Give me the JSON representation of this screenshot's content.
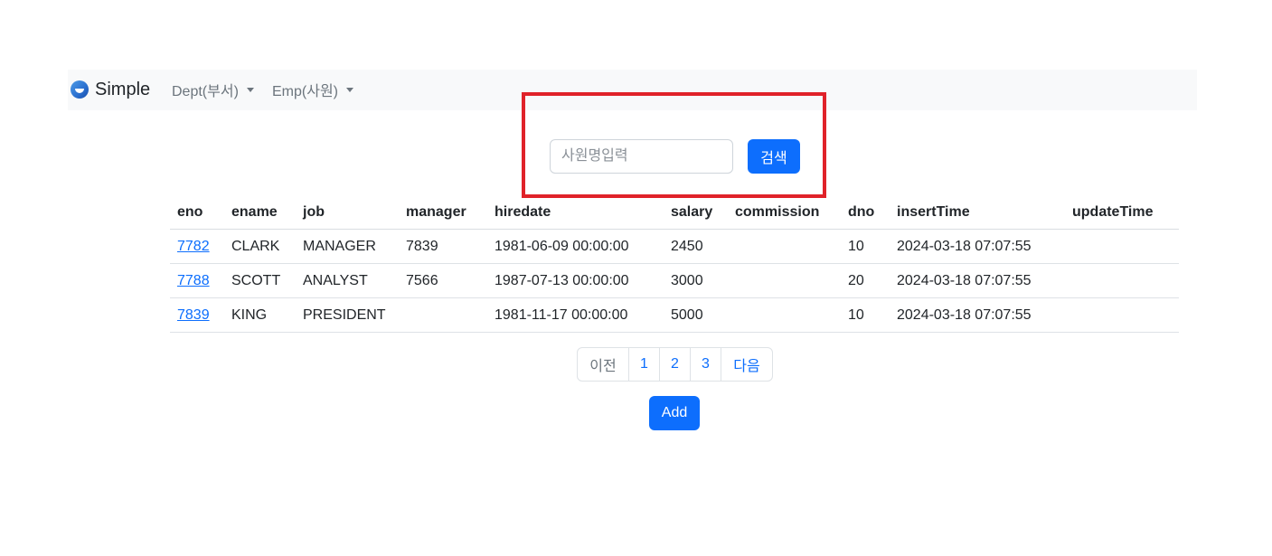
{
  "navbar": {
    "brand": "Simple",
    "menus": [
      {
        "label": "Dept(부서)"
      },
      {
        "label": "Emp(사원)"
      }
    ]
  },
  "search": {
    "placeholder": "사원명입력",
    "value": "",
    "button_label": "검색"
  },
  "table": {
    "headers": [
      "eno",
      "ename",
      "job",
      "manager",
      "hiredate",
      "salary",
      "commission",
      "dno",
      "insertTime",
      "updateTime"
    ],
    "rows": [
      [
        "7782",
        "CLARK",
        "MANAGER",
        "7839",
        "1981-06-09 00:00:00",
        "2450",
        "",
        "10",
        "2024-03-18 07:07:55",
        ""
      ],
      [
        "7788",
        "SCOTT",
        "ANALYST",
        "7566",
        "1987-07-13 00:00:00",
        "3000",
        "",
        "20",
        "2024-03-18 07:07:55",
        ""
      ],
      [
        "7839",
        "KING",
        "PRESIDENT",
        "",
        "1981-11-17 00:00:00",
        "5000",
        "",
        "10",
        "2024-03-18 07:07:55",
        ""
      ]
    ]
  },
  "pagination": {
    "prev_label": "이전",
    "pages": [
      "1",
      "2",
      "3"
    ],
    "next_label": "다음"
  },
  "actions": {
    "add_label": "Add"
  },
  "colors": {
    "primary": "#0d6efd",
    "highlight": "#e02229",
    "navbar_bg": "#f8f9fa"
  }
}
